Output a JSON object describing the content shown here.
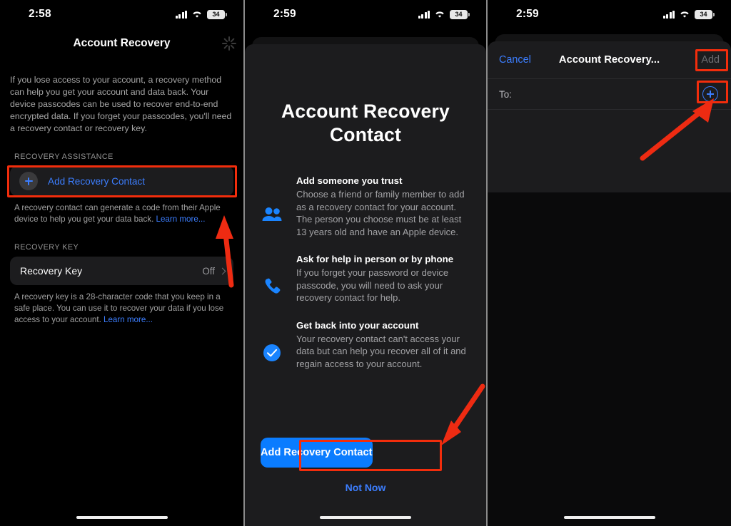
{
  "status_bar": {
    "time_panel1": "2:58",
    "time_panel2": "2:59",
    "time_panel3": "2:59",
    "battery_level": "34",
    "cellular_icon": "cellular-bars-icon",
    "wifi_icon": "wifi-icon",
    "battery_icon": "battery-icon"
  },
  "panel1": {
    "nav_title": "Account Recovery",
    "spinner_icon": "activity-spinner-icon",
    "intro": "If you lose access to your account, a recovery method can help you get your account and data back. Your device passcodes can be used to recover end-to-end encrypted data. If you forget your passcodes, you'll need a recovery contact or recovery key.",
    "section_recovery_assistance": "RECOVERY ASSISTANCE",
    "add_recovery_contact_label": "Add Recovery Contact",
    "add_icon": "plus-circle-icon",
    "contact_footnote": "A recovery contact can generate a code from their Apple device to help you get your data back.",
    "contact_footnote_link": "Learn more...",
    "section_recovery_key": "RECOVERY KEY",
    "recovery_key_label": "Recovery Key",
    "recovery_key_value": "Off",
    "chevron_icon": "chevron-right-icon",
    "key_footnote": "A recovery key is a 28-character code that you keep in a safe place. You can use it to recover your data if you lose access to your account.",
    "key_footnote_link": "Learn more..."
  },
  "panel2": {
    "title": "Account Recovery Contact",
    "features": [
      {
        "icon": "two-people-icon",
        "heading": "Add someone you trust",
        "description": "Choose a friend or family member to add as a recovery contact for your account. The person you choose must be at least 13 years old and have an Apple device."
      },
      {
        "icon": "phone-icon",
        "heading": "Ask for help in person or by phone",
        "description": "If you forget your password or device passcode, you will need to ask your recovery contact for help."
      },
      {
        "icon": "checkmark-circle-icon",
        "heading": "Get back into your account",
        "description": "Your recovery contact can't access your data but can help you recover all of it and regain access to your account."
      }
    ],
    "primary_button": "Add Recovery Contact",
    "secondary_button": "Not Now"
  },
  "panel3": {
    "cancel_label": "Cancel",
    "nav_title": "Account Recovery...",
    "add_label": "Add",
    "to_label": "To:",
    "add_contact_icon": "plus-circle-outline-icon"
  },
  "annotations": {
    "highlight_color": "#f22d0c",
    "arrow_color": "#ee2b12",
    "boxes": [
      "add-recovery-contact-row",
      "add-recovery-contact-button",
      "add-nav-button",
      "add-contact-plus-button"
    ],
    "arrows": [
      "arrow-to-add-recovery-contact-row",
      "arrow-to-add-recovery-contact-button",
      "arrow-to-add-contact-plus-button"
    ]
  },
  "colors": {
    "accent_blue": "#3c7eff",
    "button_blue": "#0a7cff",
    "card_bg": "#1c1c1e",
    "page_bg": "#000000"
  }
}
